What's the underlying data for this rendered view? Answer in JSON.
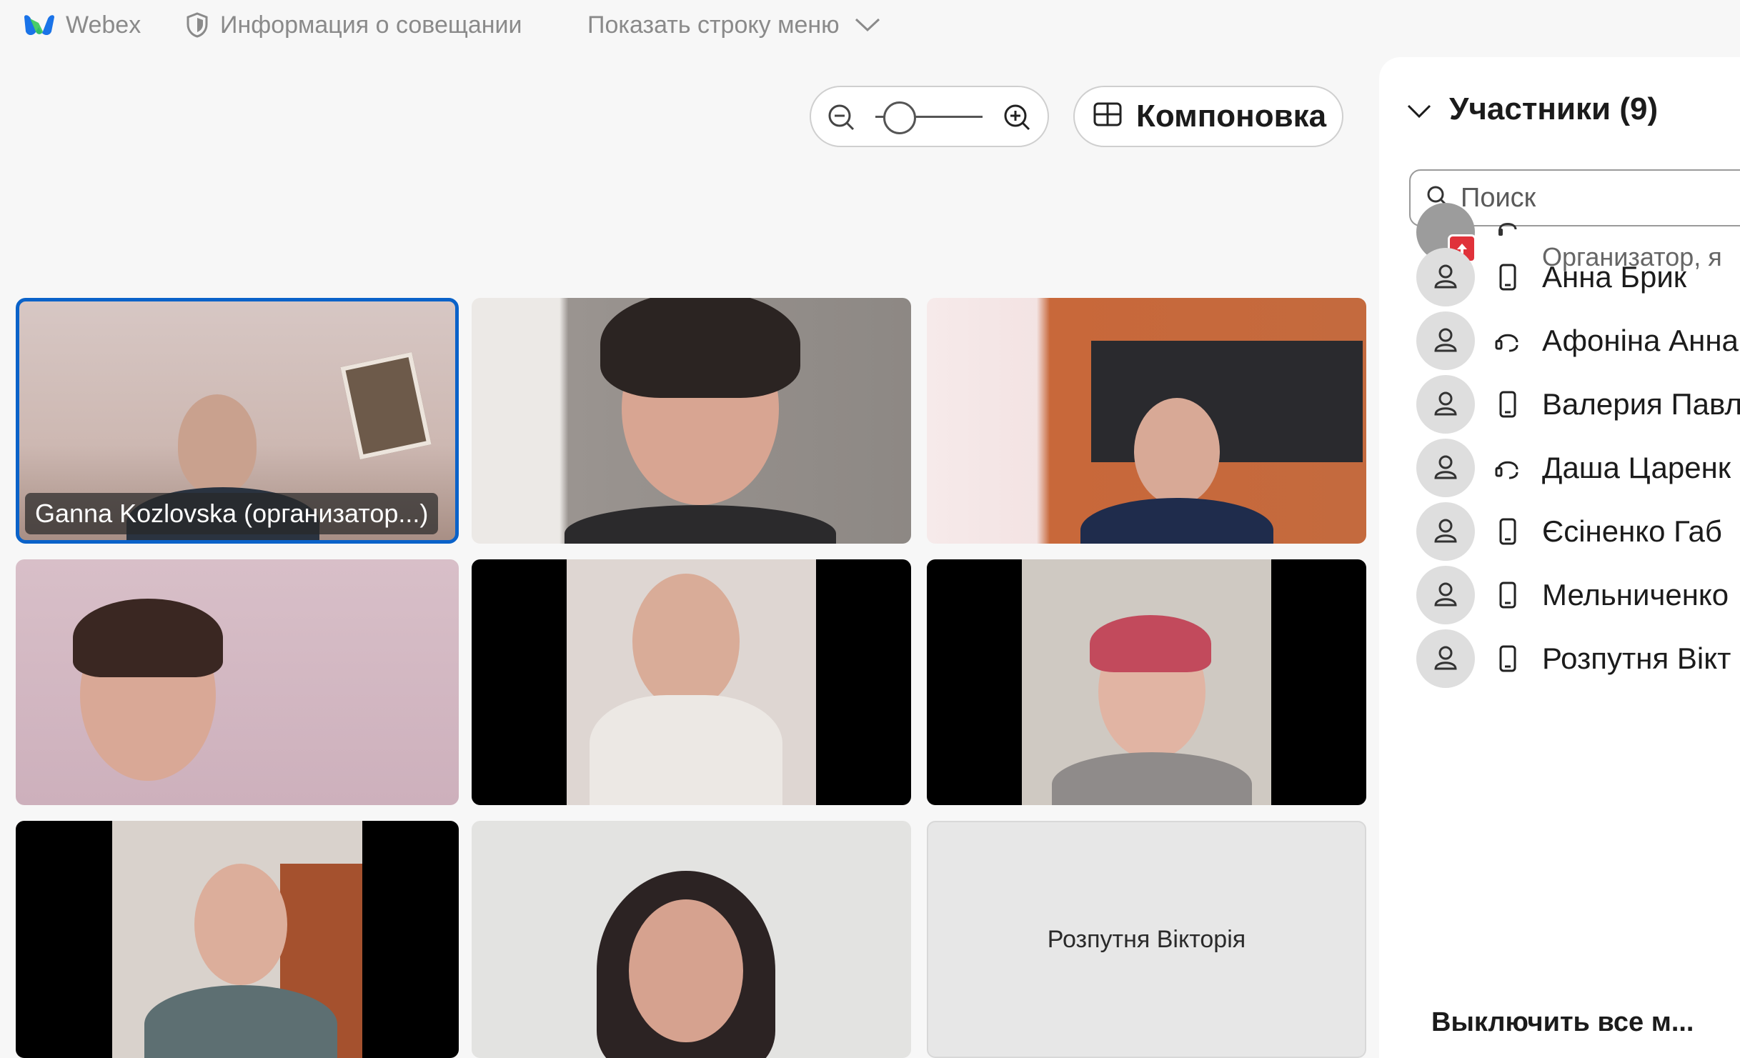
{
  "topbar": {
    "app_name": "Webex",
    "meeting_info": "Информация о совещании",
    "show_menu": "Показать строку меню"
  },
  "controls": {
    "zoom_level": 0.1,
    "layout_label": "Компоновка"
  },
  "video_tiles": [
    {
      "name_tag": "Ganna Kozlovska (организатор...)",
      "active": true
    },
    {
      "name_tag": ""
    },
    {
      "name_tag": ""
    },
    {
      "name_tag": ""
    },
    {
      "name_tag": ""
    },
    {
      "name_tag": ""
    },
    {
      "name_tag": ""
    },
    {
      "name_tag": ""
    },
    {
      "placeholder_name": "Розпутня Вікторія"
    }
  ],
  "participants_panel": {
    "title": "Участники (9)",
    "search_placeholder": "Поиск",
    "first_row_role": "Организатор, я",
    "participants": [
      {
        "name": "Анна Брик",
        "device": "phone-icon"
      },
      {
        "name": "Афоніна Анна",
        "device": "headset-icon"
      },
      {
        "name": "Валерия Павл",
        "device": "phone-icon"
      },
      {
        "name": "Даша Царенк",
        "device": "headset-icon"
      },
      {
        "name": "Єсіненко Габ",
        "device": "phone-icon"
      },
      {
        "name": "Мельниченко",
        "device": "phone-icon"
      },
      {
        "name": "Розпутня Вікт",
        "device": "phone-icon"
      }
    ],
    "mute_all_label": "Выключить все м..."
  },
  "colors": {
    "active_tile_border": "#0a62c9",
    "panel_bg": "#ffffff",
    "page_bg": "#f7f7f7"
  }
}
